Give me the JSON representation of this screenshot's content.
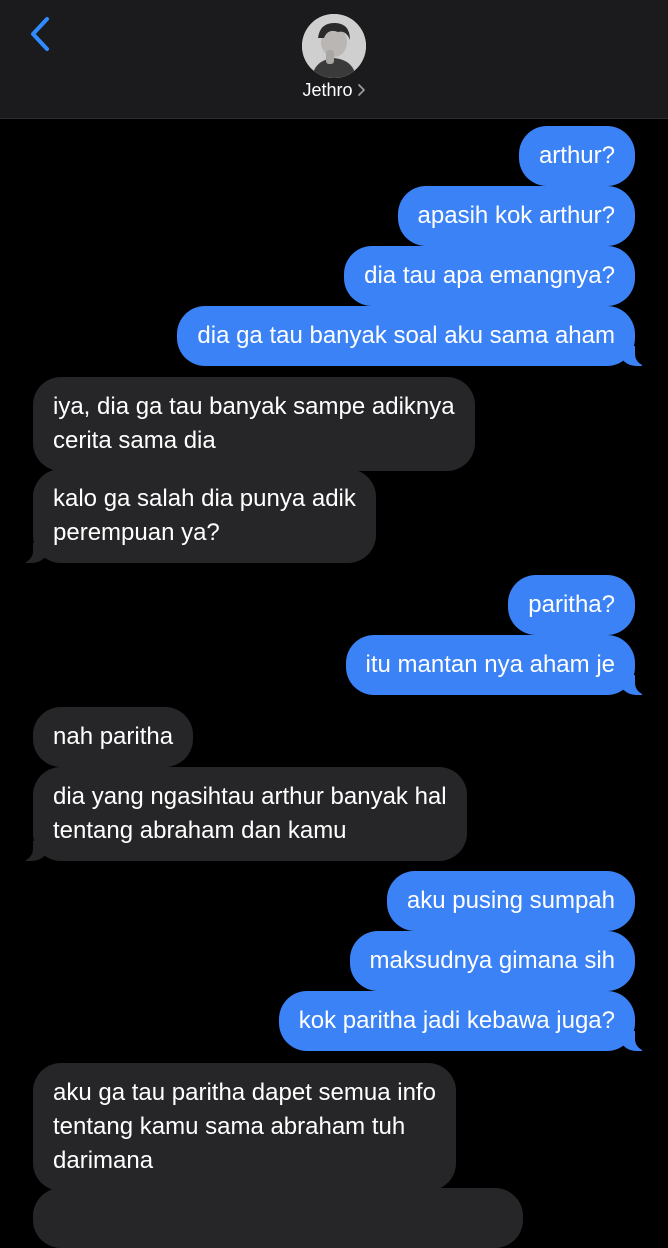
{
  "header": {
    "contact_name": "Jethro",
    "back_icon": "chevron-left-icon",
    "details_icon": "chevron-right-icon"
  },
  "colors": {
    "outgoing_bubble": "#3b82f6",
    "incoming_bubble": "#262628",
    "background": "#000000",
    "header": "#1b1b1d"
  },
  "messages": [
    {
      "from": "me",
      "text": "arthur?"
    },
    {
      "from": "me",
      "text": "apasih kok arthur?"
    },
    {
      "from": "me",
      "text": "dia tau apa emangnya?"
    },
    {
      "from": "me",
      "text": "dia ga tau banyak soal aku sama aham"
    },
    {
      "from": "them",
      "text": "iya, dia ga tau banyak sampe adiknya\ncerita sama dia"
    },
    {
      "from": "them",
      "text": "kalo ga salah dia punya adik\nperempuan ya?"
    },
    {
      "from": "me",
      "text": "paritha?"
    },
    {
      "from": "me",
      "text": "itu mantan nya aham je"
    },
    {
      "from": "them",
      "text": "nah paritha"
    },
    {
      "from": "them",
      "text": "dia yang ngasihtau arthur banyak hal\ntentang abraham dan kamu"
    },
    {
      "from": "me",
      "text": "aku pusing sumpah"
    },
    {
      "from": "me",
      "text": "maksudnya gimana sih"
    },
    {
      "from": "me",
      "text": "kok paritha jadi kebawa juga?"
    },
    {
      "from": "them",
      "text": "aku ga tau paritha dapet semua info\ntentang kamu sama abraham tuh\ndarimana"
    },
    {
      "from": "them",
      "text": ""
    }
  ]
}
